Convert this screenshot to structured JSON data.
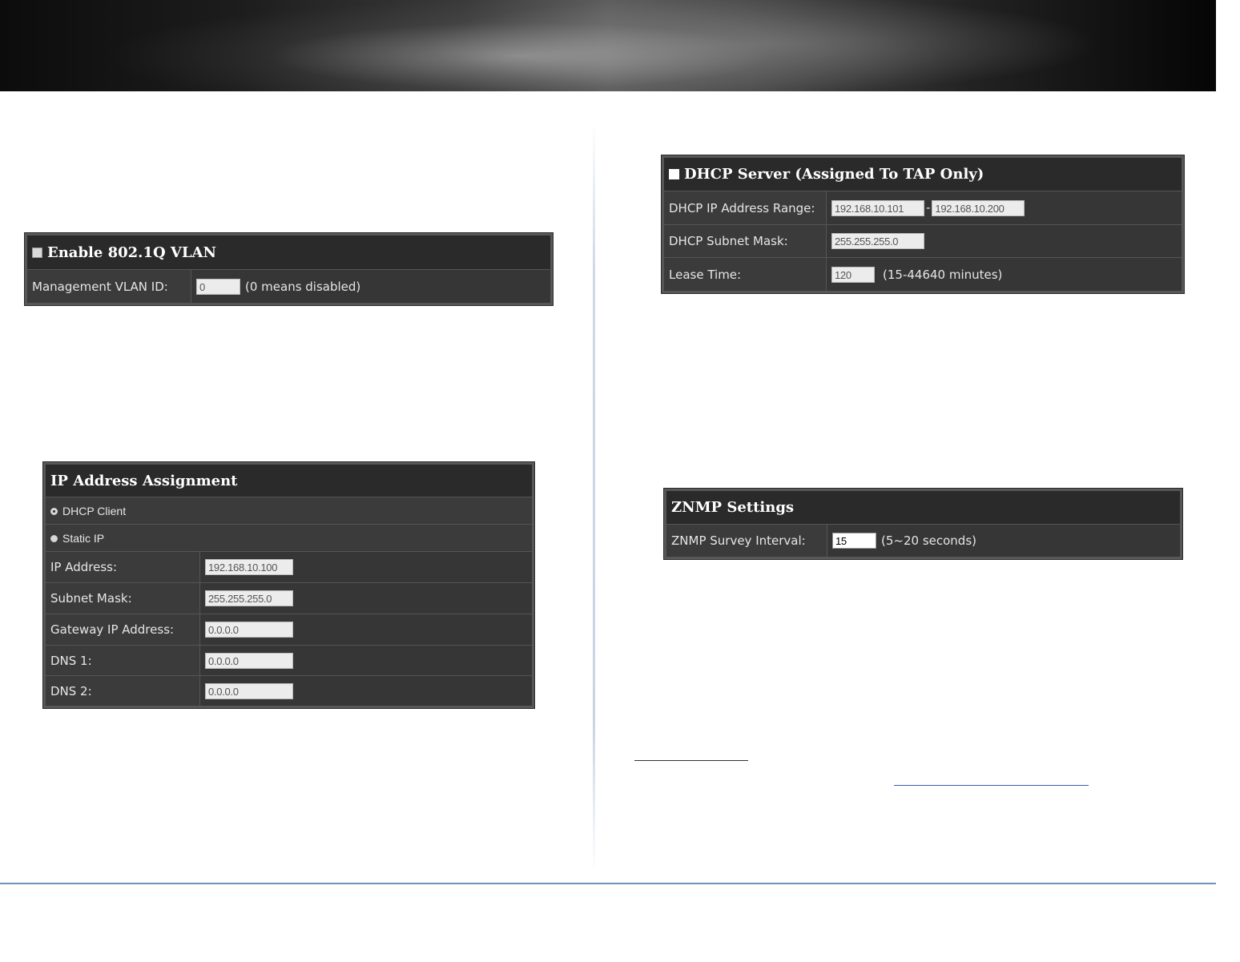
{
  "vlan": {
    "title": "Enable 802.1Q VLAN",
    "mgmt_label": "Management VLAN ID:",
    "mgmt_value": "0",
    "mgmt_hint": "(0 means disabled)"
  },
  "ip_assignment": {
    "title": "IP Address Assignment",
    "dhcp_client": "DHCP Client",
    "static_ip": "Static IP",
    "selected": "DHCP Client",
    "fields": [
      {
        "label": "IP Address:",
        "value": "192.168.10.100"
      },
      {
        "label": "Subnet Mask:",
        "value": "255.255.255.0"
      },
      {
        "label": "Gateway IP Address:",
        "value": "0.0.0.0"
      },
      {
        "label": "DNS 1:",
        "value": "0.0.0.0"
      },
      {
        "label": "DNS 2:",
        "value": "0.0.0.0"
      }
    ]
  },
  "dhcp_server": {
    "title": "DHCP Server (Assigned To TAP Only)",
    "range_label": "DHCP IP Address Range:",
    "range_start": "192.168.10.101",
    "range_separator": "-",
    "range_end": "192.168.10.200",
    "subnet_label": "DHCP Subnet Mask:",
    "subnet_value": "255.255.255.0",
    "lease_label": "Lease Time:",
    "lease_value": "120",
    "lease_hint": "(15-44640 minutes)"
  },
  "znmp": {
    "title": "ZNMP Settings",
    "interval_label": "ZNMP Survey Interval:",
    "interval_value": "15",
    "interval_hint": "(5~20 seconds)"
  }
}
